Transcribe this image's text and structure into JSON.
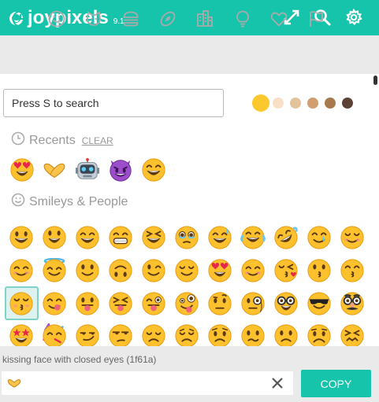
{
  "app": {
    "brand": "joypixels",
    "version": "9.1"
  },
  "header": {
    "icons": [
      "expand-icon",
      "search-icon",
      "gear-icon"
    ]
  },
  "categories": [
    {
      "name": "recent-icon",
      "active": true
    },
    {
      "name": "smiley-icon"
    },
    {
      "name": "animal-icon"
    },
    {
      "name": "food-icon"
    },
    {
      "name": "activity-icon"
    },
    {
      "name": "travel-icon"
    },
    {
      "name": "objects-icon"
    },
    {
      "name": "heart-icon"
    },
    {
      "name": "flag-icon"
    }
  ],
  "search": {
    "placeholder": "Press S to search",
    "value": ""
  },
  "skin_tones": [
    "#fdc82d",
    "#f9dfc6",
    "#e3c39b",
    "#d19e70",
    "#a77a4e",
    "#5b4236"
  ],
  "recents": {
    "title": "Recents",
    "clear_label": "CLEAR",
    "emojis": [
      "smiling-face-heart-eyes",
      "heart-hands",
      "robot-face",
      "smiling-face-with-horns",
      "beaming-face"
    ]
  },
  "smileys": {
    "title": "Smileys & People",
    "rows": [
      [
        "grinning",
        "smiley",
        "smile",
        "grin",
        "laughing",
        "holding-back-tears",
        "sweat-smile",
        "joy",
        "rofl",
        "smiling-tear",
        "relaxed"
      ],
      [
        "blush",
        "innocent",
        "slight-smile",
        "upside-down",
        "wink",
        "relieved",
        "heart-eyes",
        "smiling-face-hearts",
        "kissing-heart",
        "kissing",
        "kissing-smiling-eyes"
      ],
      [
        "kissing-closed-eyes",
        "yum",
        "stuck-out-tongue",
        "stuck-out-tongue-closed-eyes",
        "stuck-out-tongue-wink",
        "zany",
        "raised-eyebrow",
        "monocle",
        "nerd",
        "sunglasses",
        "disguised"
      ],
      [
        "star-struck",
        "partying",
        "smirk",
        "unamused",
        "disappointed",
        "pensive",
        "worried",
        "confused",
        "slightly-frowning",
        "frowning",
        "persevere"
      ]
    ]
  },
  "selected": {
    "name": "kissing face with closed eyes (1f61a)",
    "row": 2,
    "col": 0
  },
  "output": {
    "value": "🫶"
  },
  "copy_label": "COPY"
}
